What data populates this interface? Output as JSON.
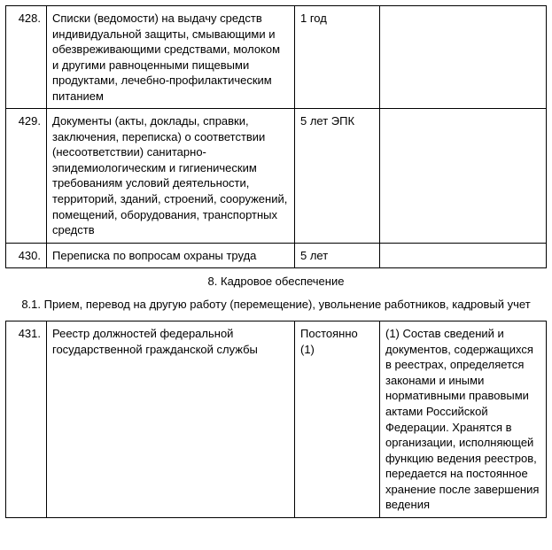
{
  "rows": [
    {
      "num": "428.",
      "desc": "Списки (ведомости) на выдачу средств индивидуальной защиты, смывающими и обезвреживающими средствами, молоком и другими равноценными пищевыми продуктами, лечебно-профилактическим питанием",
      "term": "1 год",
      "note": ""
    },
    {
      "num": "429.",
      "desc": "Документы (акты, доклады, справки, заключения, переписка) о соответствии (несоответствии) санитарно-эпидемиологическим и гигиеническим требованиям условий деятельности, территорий, зданий, строений, сооружений, помещений, оборудования, транспортных средств",
      "term": "5 лет ЭПК",
      "note": ""
    },
    {
      "num": "430.",
      "desc": "Переписка по вопросам охраны труда",
      "term": "5 лет",
      "note": ""
    }
  ],
  "section": "8. Кадровое обеспечение",
  "subsection": "8.1. Прием, перевод на другую работу (перемещение), увольнение работников, кадровый учет",
  "rows2": [
    {
      "num": "431.",
      "desc": "Реестр должностей федеральной государственной гражданской службы",
      "term": "Постоянно (1)",
      "note": "(1) Состав сведений и документов, содержащихся в реестрах, определяется законами и иными нормативными правовыми актами Российской Федерации. Хранятся в организации, исполняющей функцию ведения реестров, передается на постоянное хранение после завершения ведения"
    }
  ]
}
